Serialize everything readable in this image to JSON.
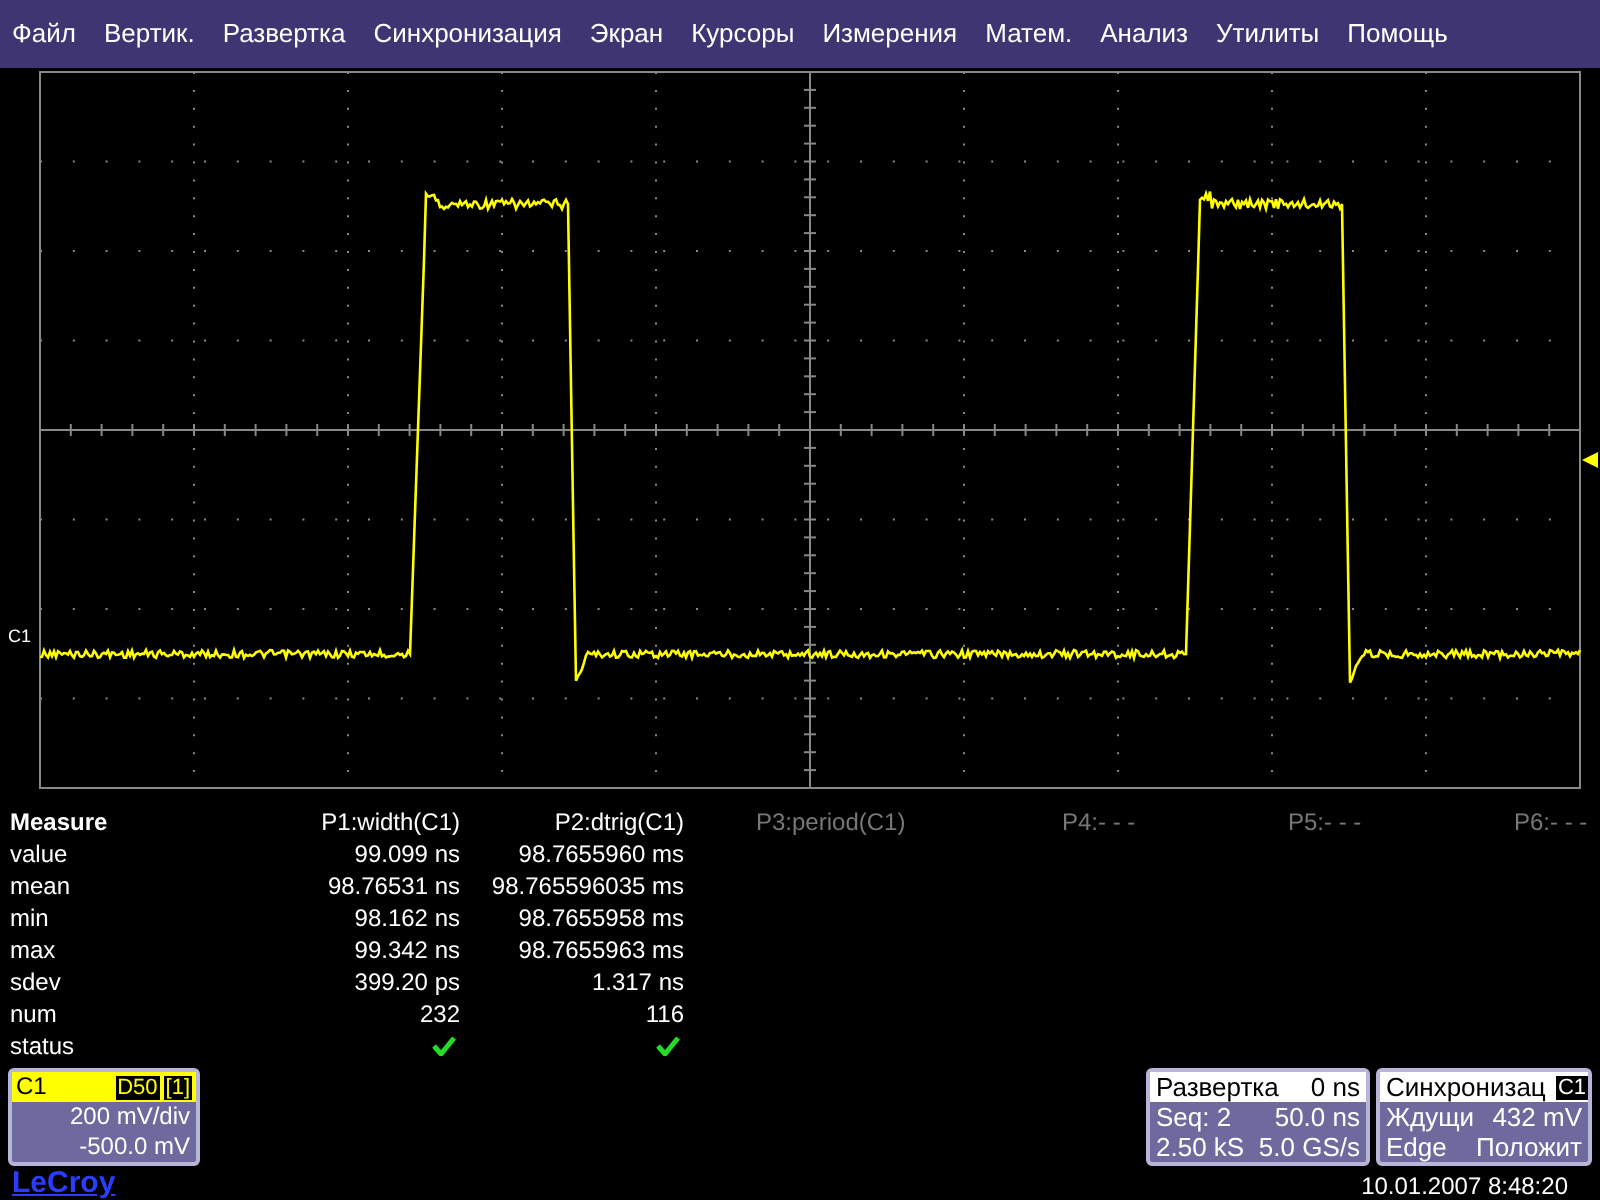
{
  "menu": [
    "Файл",
    "Вертик.",
    "Развертка",
    "Синхронизация",
    "Экран",
    "Курсоры",
    "Измерения",
    "Матем.",
    "Анализ",
    "Утилиты",
    "Помощь"
  ],
  "display": {
    "channel_label": "C1"
  },
  "measure": {
    "title": "Measure",
    "row_labels": [
      "value",
      "mean",
      "min",
      "max",
      "sdev",
      "num",
      "status"
    ],
    "params": [
      {
        "label": "P1:width(C1)",
        "active": true,
        "values": [
          "99.099 ns",
          "98.76531 ns",
          "98.162 ns",
          "99.342 ns",
          "399.20 ps",
          "232"
        ],
        "status_ok": true
      },
      {
        "label": "P2:dtrig(C1)",
        "active": true,
        "values": [
          "98.7655960 ms",
          "98.765596035 ms",
          "98.7655958 ms",
          "98.7655963 ms",
          "1.317 ns",
          "116"
        ],
        "status_ok": true
      },
      {
        "label": "P3:period(C1)",
        "active": false
      },
      {
        "label": "P4:- - -",
        "active": false
      },
      {
        "label": "P5:- - -",
        "active": false
      },
      {
        "label": "P6:- - -",
        "active": false
      }
    ]
  },
  "channel": {
    "name": "C1",
    "badges": [
      "D50",
      "[1]"
    ],
    "scale": "200 mV/div",
    "offset": "-500.0 mV"
  },
  "brand": "LeCroy",
  "timebase": {
    "title": "Развертка",
    "delay": "0 ns",
    "rows": [
      {
        "left": "Seq: 2",
        "right": "50.0 ns"
      },
      {
        "left": "2.50 kS",
        "right": "5.0 GS/s"
      }
    ]
  },
  "trigger": {
    "title": "Синхронизац",
    "source": "C1",
    "rows": [
      {
        "left": "Ждущи",
        "right": "432 mV"
      },
      {
        "left": "Edge",
        "right": "Положит"
      }
    ]
  },
  "timestamp": "10.01.2007 8:48:20"
}
